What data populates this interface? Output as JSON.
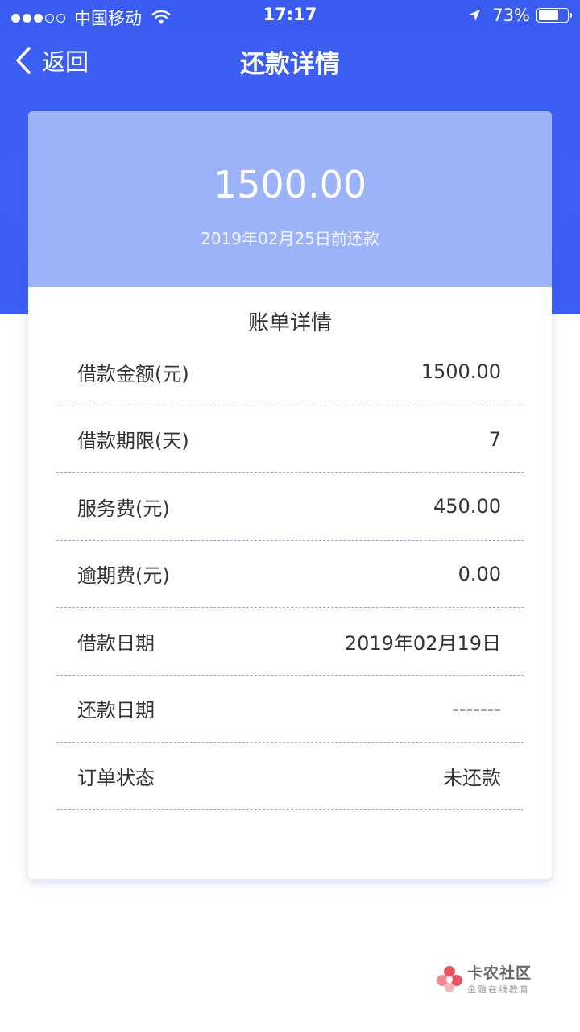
{
  "status_bar": {
    "carrier": "中国移动",
    "time": "17:17",
    "battery": "73%",
    "battery_level": 0.73
  },
  "nav": {
    "back_label": "返回",
    "title": "还款详情"
  },
  "summary": {
    "amount": "1500.00",
    "due_text": "2019年02月25日前还款"
  },
  "details": {
    "title": "账单详情",
    "rows": [
      {
        "label": "借款金额(元)",
        "value": "1500.00"
      },
      {
        "label": "借款期限(天)",
        "value": "7"
      },
      {
        "label": "服务费(元)",
        "value": "450.00"
      },
      {
        "label": "逾期费(元)",
        "value": "0.00"
      },
      {
        "label": "借款日期",
        "value": "2019年02月19日"
      },
      {
        "label": "还款日期",
        "value": "-------"
      },
      {
        "label": "订单状态",
        "value": "未还款"
      }
    ]
  },
  "watermark": {
    "title": "卡农社区",
    "subtitle": "金融在线教育"
  },
  "colors": {
    "header_blue": "#3b5df2",
    "card_header": "#9db3f9",
    "divider": "#9aa5e6"
  }
}
